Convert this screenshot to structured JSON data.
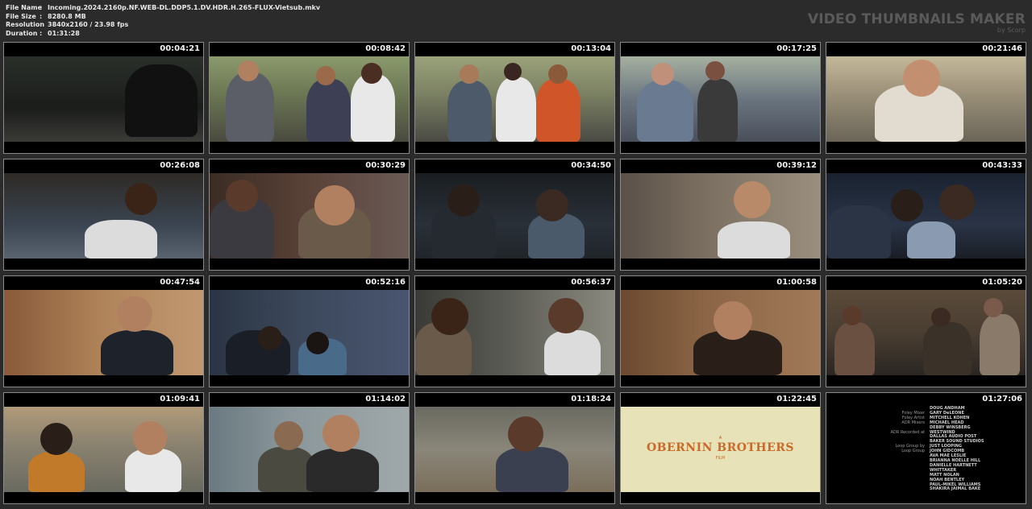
{
  "header": {
    "file_name_label": "File Name",
    "file_name_value": "Incoming.2024.2160p.NF.WEB-DL.DDP5.1.DV.HDR.H.265-FLUX-Vietsub.mkv",
    "file_size_label": "File Size",
    "file_size_value": "8280.8 MB",
    "resolution_label": "Resolution",
    "resolution_value": "3840x2160 / 23.98 fps",
    "duration_label": "Duration",
    "duration_value": "01:31:28",
    "separator": ":"
  },
  "brand": {
    "title": "VIDEO THUMBNAILS MAKER",
    "subtitle": "by Scorp"
  },
  "thumbnails": [
    {
      "time": "00:04:21"
    },
    {
      "time": "00:08:42"
    },
    {
      "time": "00:13:04"
    },
    {
      "time": "00:17:25"
    },
    {
      "time": "00:21:46"
    },
    {
      "time": "00:26:08"
    },
    {
      "time": "00:30:29"
    },
    {
      "time": "00:34:50"
    },
    {
      "time": "00:39:12"
    },
    {
      "time": "00:43:33"
    },
    {
      "time": "00:47:54"
    },
    {
      "time": "00:52:16"
    },
    {
      "time": "00:56:37"
    },
    {
      "time": "01:00:58"
    },
    {
      "time": "01:05:20"
    },
    {
      "time": "01:09:41"
    },
    {
      "time": "01:14:02"
    },
    {
      "time": "01:18:24"
    },
    {
      "time": "01:22:45"
    },
    {
      "time": "01:27:06"
    }
  ],
  "logo": {
    "pre": "A",
    "name": "OBERNIN BROTHERS",
    "sub": "FILM"
  },
  "credits": [
    {
      "role": "",
      "name": "DOUG ANDHAM"
    },
    {
      "role": "Foley Mixer",
      "name": "GARY DeLEONE"
    },
    {
      "role": "Foley Artist",
      "name": "MITCHELL KOHEN"
    },
    {
      "role": "ADR Mixers",
      "name": "MICHAEL HEAD"
    },
    {
      "role": "",
      "name": "DEBBY WINSBERG"
    },
    {
      "role": "ADR Recorded at",
      "name": "WESTWIND"
    },
    {
      "role": "",
      "name": "DALLAS AUDIO POST"
    },
    {
      "role": "",
      "name": "BAKER SOUND STUDIOS"
    },
    {
      "role": "Loop Group by",
      "name": "JUST LOOPING"
    },
    {
      "role": "Loop Group",
      "name": "JOHN GIDCOMB"
    },
    {
      "role": "",
      "name": "AVA MAE LESLIE"
    },
    {
      "role": "",
      "name": "BRIANNA NOELLE HILL"
    },
    {
      "role": "",
      "name": "DANIELLE HARTNETT"
    },
    {
      "role": "",
      "name": "WHITTAKER"
    },
    {
      "role": "",
      "name": "MATT NOLAN"
    },
    {
      "role": "",
      "name": "NOAH BENTLEY"
    },
    {
      "role": "",
      "name": "PAUL-MIKÉL WILLIAMS"
    },
    {
      "role": "",
      "name": "SHAKIRA JAIMAL BAKE"
    }
  ]
}
